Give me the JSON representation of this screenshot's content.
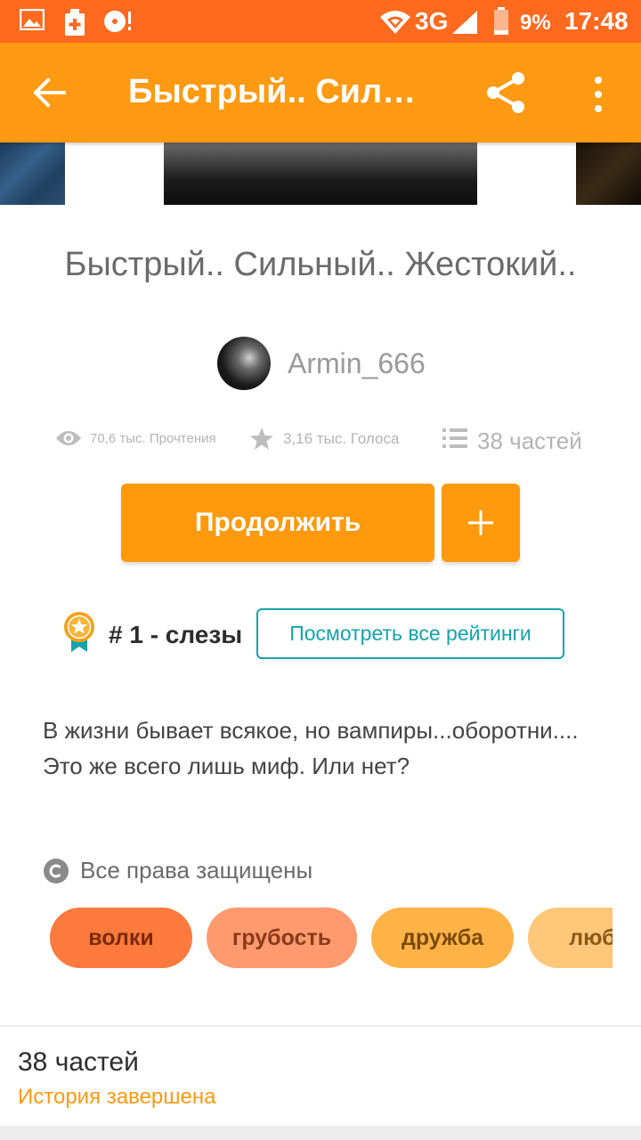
{
  "status_bar": {
    "network": "3G",
    "battery": "9%",
    "time": "17:48"
  },
  "app_bar": {
    "title": "Быстрый.. Силь..."
  },
  "story": {
    "title": "Быстрый.. Сильный.. Жестокий..",
    "author": "Armin_666",
    "reads": "70,6 тыс. Прочтения",
    "votes": "3,16 тыс. Голоса",
    "parts": "38 частей",
    "description": "В жизни бывает всякое, но вампиры...оборотни.... Это же всего лишь миф. Или нет?",
    "copyright": "Все права защищены"
  },
  "actions": {
    "continue_label": "Продолжить",
    "add_label": "+"
  },
  "ranking": {
    "text": "# 1 - слезы",
    "view_all_label": "Посмотреть все рейтинги"
  },
  "tags": [
    {
      "label": "волки",
      "color": "#ff7a3d",
      "text_color": "#7a2a0a"
    },
    {
      "label": "грубость",
      "color": "#ff9a6e",
      "text_color": "#8a3a1a"
    },
    {
      "label": "дружба",
      "color": "#ffb347",
      "text_color": "#7a4a0a"
    },
    {
      "label": "любо",
      "color": "#ffc77a",
      "text_color": "#8a5a1a"
    }
  ],
  "footer": {
    "parts": "38 частей",
    "status": "История завершена"
  },
  "colors": {
    "status_bar": "#ff6a1f",
    "app_bar": "#ff9a12",
    "button": "#ff9a0c",
    "accent_teal": "#14a3ad"
  }
}
